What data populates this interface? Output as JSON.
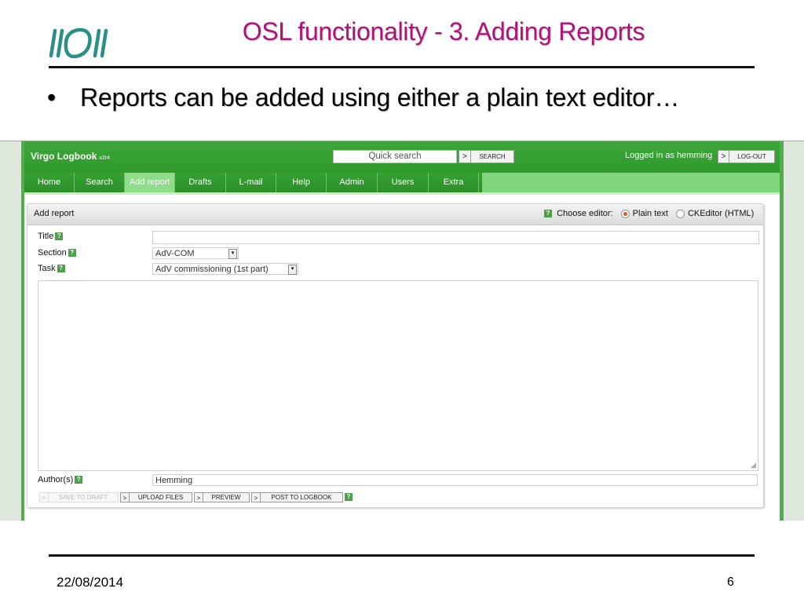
{
  "slide": {
    "title": "OSL functionality - 3. Adding Reports",
    "bullet_marker": "•",
    "bullet_text": "Reports can be added using either a plain text editor…",
    "date": "22/08/2014",
    "page_number": "6",
    "title_color": "#b0127a"
  },
  "app": {
    "name": "Virgo Logbook",
    "version": "v2r4",
    "accent_color": "#3ea63a",
    "search": {
      "placeholder": "Quick search",
      "arrow": ">",
      "button_label": "SEARCH"
    },
    "login": {
      "text": "Logged in as hemming",
      "arrow": ">",
      "button_label": "LOG-OUT"
    },
    "nav": [
      {
        "label": "Home",
        "active": false
      },
      {
        "label": "Search",
        "active": false
      },
      {
        "label": "Add report",
        "active": true
      },
      {
        "label": "Drafts",
        "active": false
      },
      {
        "label": "L-mail",
        "active": false
      },
      {
        "label": "Help",
        "active": false
      },
      {
        "label": "Admin",
        "active": false
      },
      {
        "label": "Users",
        "active": false
      },
      {
        "label": "Extra",
        "active": false
      }
    ]
  },
  "panel": {
    "title": "Add report",
    "help_icon": "?",
    "choose_editor_label": "Choose editor:",
    "editor_options": [
      {
        "label": "Plain text",
        "checked": true
      },
      {
        "label": "CKEditor (HTML)",
        "checked": false
      }
    ]
  },
  "form": {
    "title_label": "Title",
    "section_label": "Section",
    "section_value": "AdV-COM",
    "task_label": "Task",
    "task_value": "AdV commissioning (1st part)",
    "dropdown_glyph": "▾",
    "title_value": "",
    "body_value": "",
    "authors_label": "Author(s)",
    "authors_value": "Hemming"
  },
  "actions": {
    "arrow": ">",
    "save_draft": "SAVE TO DRAFT",
    "upload_files": "UPLOAD FILES",
    "preview": "PREVIEW",
    "post": "POST TO LOGBOOK"
  }
}
